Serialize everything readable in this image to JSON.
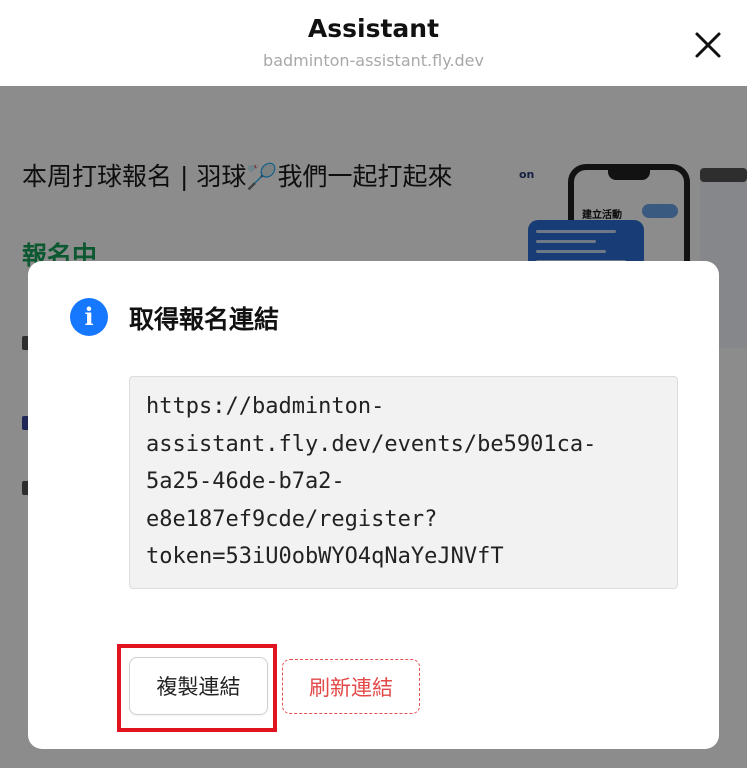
{
  "header": {
    "title": "Assistant",
    "subtitle": "badminton-assistant.fly.dev"
  },
  "background_page": {
    "headline": "本周打球報名 | 羽球🏸我們一起打起來",
    "status": "報名中",
    "promo_edge_text": "on",
    "promo_phone_title": "建立活動"
  },
  "dialog": {
    "title": "取得報名連結",
    "link_lines": [
      "https://badminton-",
      "assistant.fly.dev/events/be5901ca-",
      "5a25-46de-b7a2-",
      "e8e187ef9cde/register?",
      "token=53iU0obWYO4qNaYeJNVfT"
    ],
    "copy_button": "複製連結",
    "refresh_button": "刷新連結"
  },
  "colors": {
    "info_icon": "#1677ff",
    "status_green": "#14a05a",
    "refresh_red": "#e34848",
    "highlight_red": "#e0141e"
  }
}
